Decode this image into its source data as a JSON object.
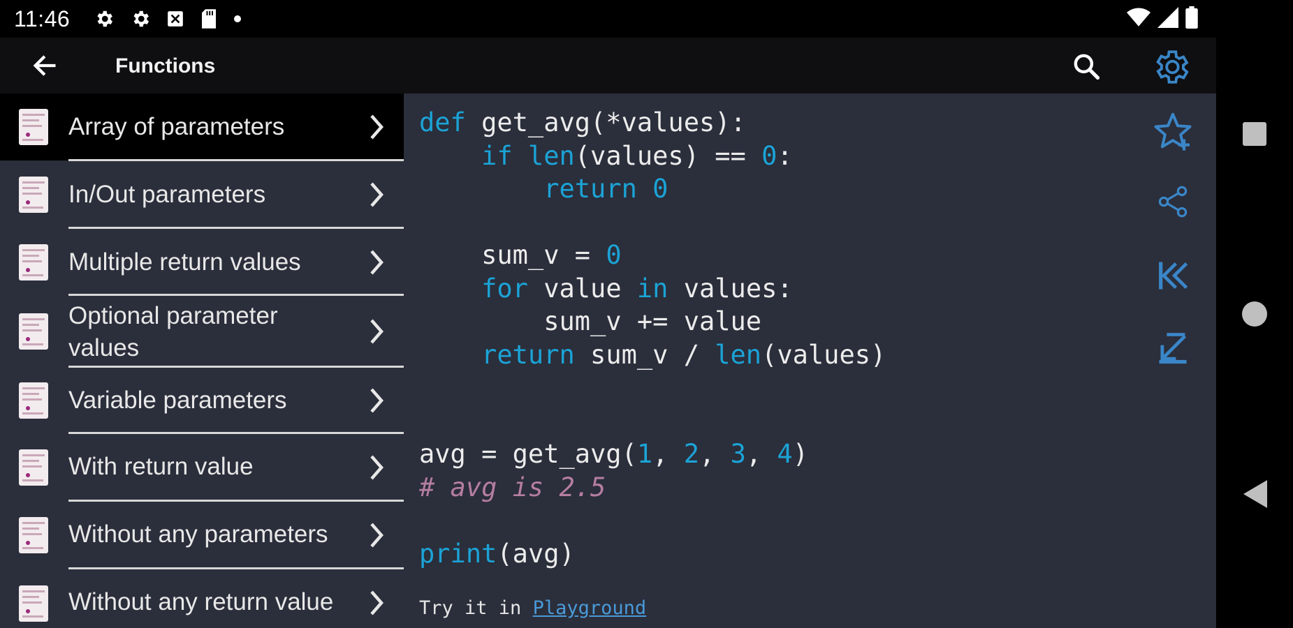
{
  "status": {
    "time": "11:46"
  },
  "appbar": {
    "title": "Functions"
  },
  "sidebar": {
    "items": [
      {
        "label": "Array of parameters"
      },
      {
        "label": "In/Out parameters"
      },
      {
        "label": "Multiple return values"
      },
      {
        "label": "Optional parameter values"
      },
      {
        "label": "Variable parameters"
      },
      {
        "label": "With return value"
      },
      {
        "label": "Without any parameters"
      },
      {
        "label": "Without any return value"
      }
    ]
  },
  "code": {
    "lines": [
      "def get_avg(*values):",
      "    if len(values) == 0:",
      "        return 0",
      "",
      "    sum_v = 0",
      "    for value in values:",
      "        sum_v += value",
      "    return sum_v / len(values)",
      "",
      "",
      "avg = get_avg(1, 2, 3, 4)",
      "# avg is 2.5",
      "",
      "print(avg)"
    ],
    "try_prefix": "Try it in ",
    "try_link": "Playground"
  },
  "icons": {
    "settings": "gear-icon",
    "search": "search-icon",
    "back": "arrow-left-icon",
    "favorite": "star-add-icon",
    "share": "share-icon",
    "first": "skip-first-icon",
    "last": "skip-last-icon"
  },
  "colors": {
    "accent": "#3a86c8",
    "keyword": "#1ba3d6",
    "comment": "#b57ea0",
    "panel": "#2b2e3b"
  }
}
